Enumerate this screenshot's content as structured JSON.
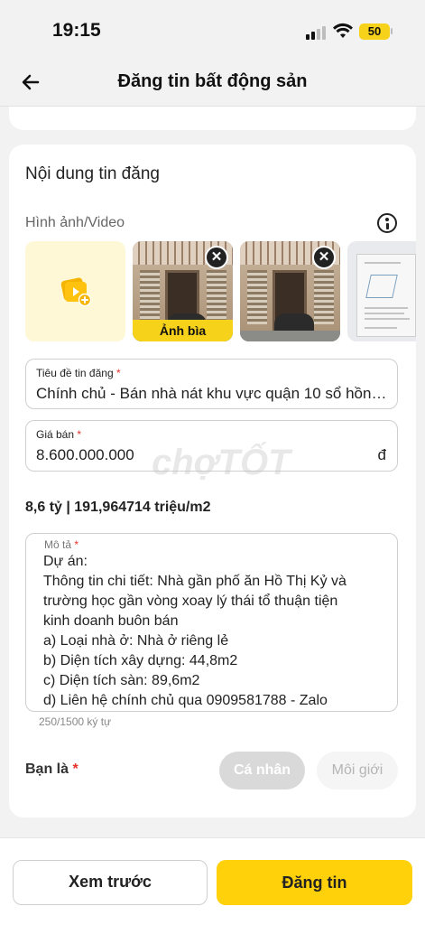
{
  "status_bar": {
    "time": "19:15",
    "battery": "50"
  },
  "header": {
    "title": "Đăng tin bất động sản"
  },
  "form": {
    "section_title": "Nội dung tin đăng",
    "media_label": "Hình ảnh/Video",
    "cover_label": "Ảnh bìa",
    "remove_symbol": "✕",
    "title_field": {
      "label": "Tiêu đề tin đăng",
      "required_mark": "*",
      "value": "Chính chủ - Bán nhà nát khu vực quận 10 sổ hồng…"
    },
    "price_field": {
      "label": "Giá bán",
      "required_mark": "*",
      "value": "8.600.000.000",
      "currency": "đ"
    },
    "watermark": "chợTỐT",
    "price_summary": "8,6 tỷ | 191,964714 triệu/m2",
    "description": {
      "label": "Mô tả",
      "required_mark": "*",
      "lines": [
        "Dự án:",
        "Thông tin chi tiết: Nhà gần phố ăn Hồ Thị Kỷ và",
        "trường học gần vòng xoay lý thái tổ thuận tiện",
        "kinh doanh buôn bán",
        "a) Loại nhà ở: Nhà ở riêng lẻ",
        "b) Diện tích xây dựng: 44,8m2",
        "c) Diện tích sàn: 89,6m2",
        "d) Liên hệ chính chủ qua 0909581788 - Zalo"
      ],
      "char_count": "250/1500 ký tự"
    },
    "role": {
      "label": "Bạn là",
      "required_mark": "*",
      "options": [
        "Cá nhân",
        "Môi giới"
      ],
      "selected": "Cá nhân"
    }
  },
  "actions": {
    "preview": "Xem trước",
    "post": "Đăng tin"
  },
  "colors": {
    "accent": "#ffd10a",
    "required": "#e4312b",
    "chip_selected": "#d9d9d9"
  }
}
